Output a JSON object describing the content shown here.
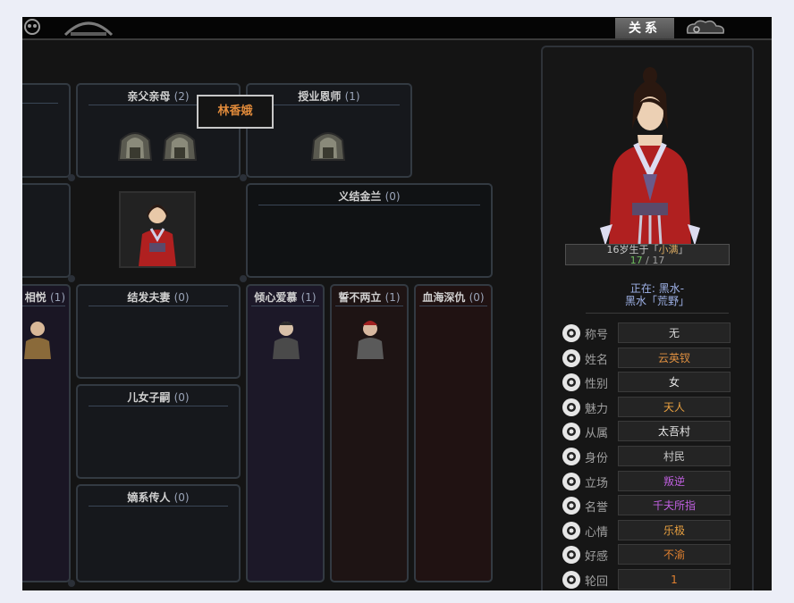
{
  "topbar": {
    "relation_tab": "关系"
  },
  "tree": {
    "featured_name": "林香娥",
    "panels": [
      {
        "id": "parents",
        "label": "亲父亲母",
        "count": "(2)"
      },
      {
        "id": "mentor",
        "label": "授业恩师",
        "count": "(1)"
      },
      {
        "id": "sworn",
        "label": "义结金兰",
        "count": "(0)"
      },
      {
        "id": "mutual",
        "label": "相悦",
        "count": "(1)"
      },
      {
        "id": "spouse",
        "label": "结发夫妻",
        "count": "(0)"
      },
      {
        "id": "admire",
        "label": "倾心爱慕",
        "count": "(1)"
      },
      {
        "id": "rival",
        "label": "誓不两立",
        "count": "(1)"
      },
      {
        "id": "enemy",
        "label": "血海深仇",
        "count": "(0)"
      },
      {
        "id": "children",
        "label": "儿女子嗣",
        "count": "(0)"
      },
      {
        "id": "heirs",
        "label": "嫡系传人",
        "count": "(0)"
      }
    ]
  },
  "character": {
    "age_prefix": "16岁生于「",
    "season": "小满",
    "age_suffix": "」",
    "hp_current": "17",
    "hp_sep": " / ",
    "hp_max": "17",
    "location_line1": "正在: 黑水-",
    "location_line2": "黑水「荒野」",
    "attributes": [
      {
        "label": "称号",
        "value": "无",
        "color": "#d8d8d8",
        "icon": "rabbit-icon"
      },
      {
        "label": "姓名",
        "value": "云英钗",
        "color": "#e09040",
        "icon": "pen-icon"
      },
      {
        "label": "性别",
        "value": "女",
        "color": "#e8e8e8",
        "icon": "gender-icon"
      },
      {
        "label": "魅力",
        "value": "天人",
        "color": "#e8a040",
        "icon": "charm-icon"
      },
      {
        "label": "从属",
        "value": "太吾村",
        "color": "#e8e8e8",
        "icon": "hand-icon"
      },
      {
        "label": "身份",
        "value": "村民",
        "color": "#c8c8c8",
        "icon": "hat-icon"
      },
      {
        "label": "立场",
        "value": "叛逆",
        "color": "#c060e0",
        "icon": "stance-icon"
      },
      {
        "label": "名誉",
        "value": "千夫所指",
        "color": "#c060e0",
        "icon": "fame-icon"
      },
      {
        "label": "心情",
        "value": "乐极",
        "color": "#e8a040",
        "icon": "mood-icon"
      },
      {
        "label": "好感",
        "value": "不渝",
        "color": "#e08030",
        "icon": "heart-icon"
      },
      {
        "label": "轮回",
        "value": "1",
        "color": "#e08030",
        "icon": "cycle-icon"
      }
    ]
  }
}
